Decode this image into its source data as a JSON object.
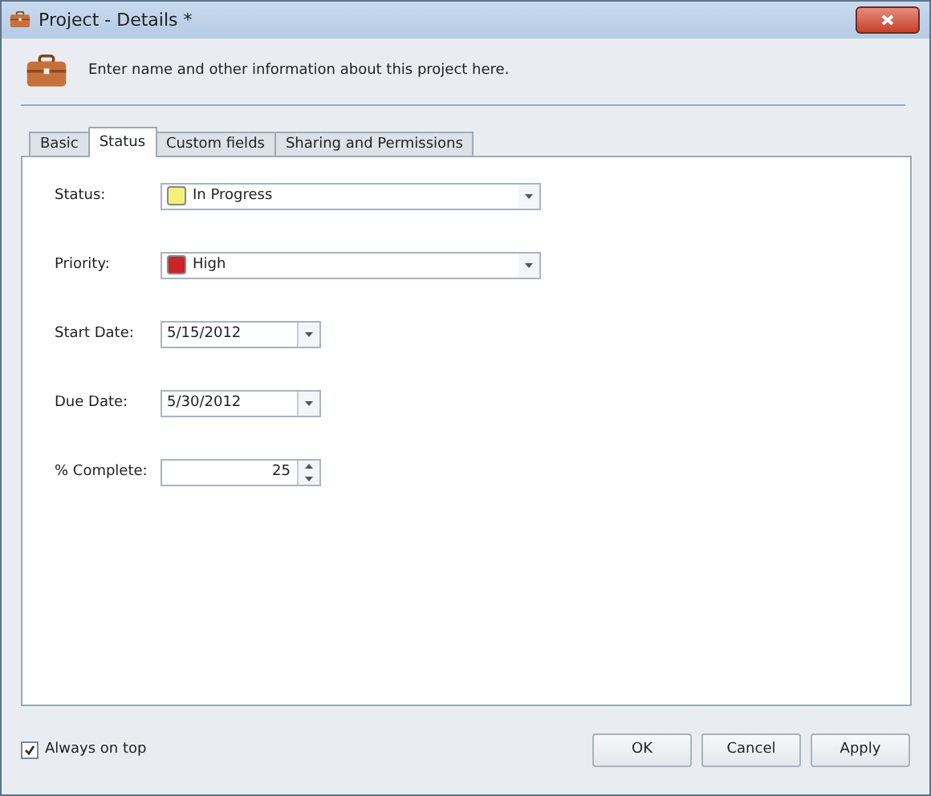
{
  "window": {
    "title": "Project - Details *"
  },
  "header": {
    "text": "Enter name and other information about this project here."
  },
  "tabs": [
    {
      "label": "Basic",
      "selected": false
    },
    {
      "label": "Status",
      "selected": true
    },
    {
      "label": "Custom fields",
      "selected": false
    },
    {
      "label": "Sharing and Permissions",
      "selected": false
    }
  ],
  "fields": [
    {
      "kind": "color-combo",
      "label": "Status:",
      "value": "In Progress",
      "color": "#f5f07a"
    },
    {
      "kind": "color-combo",
      "label": "Priority:",
      "value": "High",
      "color": "#c8242a"
    },
    {
      "kind": "date",
      "label": "Start Date:",
      "value": "5/15/2012"
    },
    {
      "kind": "date",
      "label": "Due Date:",
      "value": "5/30/2012"
    },
    {
      "kind": "spin",
      "label": "% Complete:",
      "value": "25"
    }
  ],
  "always_on_top": {
    "label": "Always on top",
    "checked": true
  },
  "buttons": [
    {
      "label": "OK"
    },
    {
      "label": "Cancel"
    },
    {
      "label": "Apply"
    }
  ]
}
